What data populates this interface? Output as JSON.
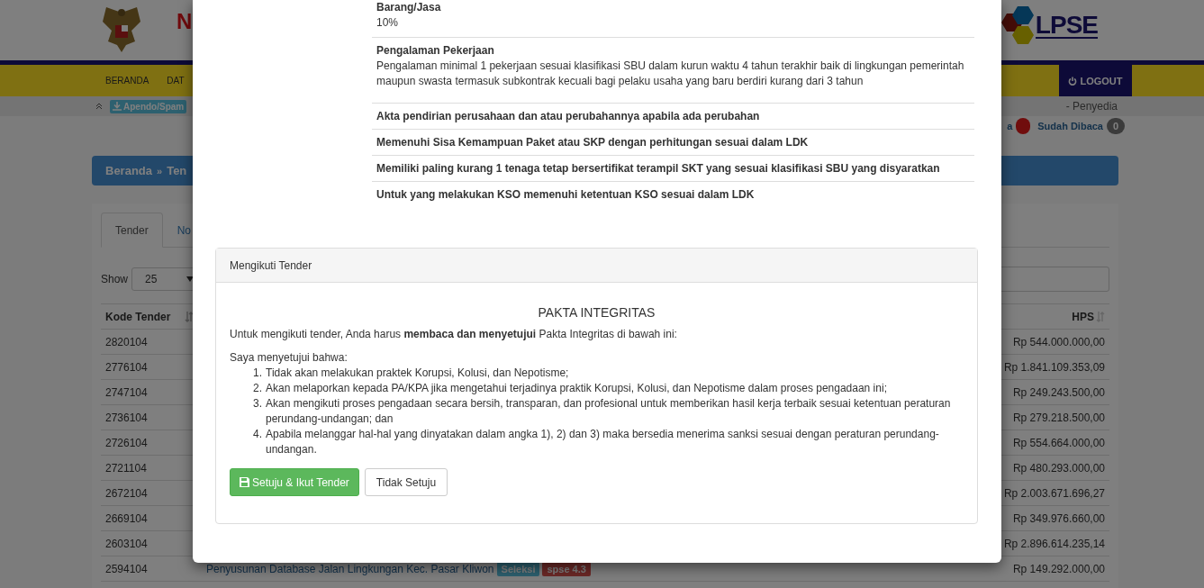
{
  "header": {
    "title_fragment": "N",
    "logo_text": "LPSE"
  },
  "nav": {
    "items": [
      {
        "label": "BERANDA"
      },
      {
        "label": "DAT"
      }
    ],
    "logout": "LOGOUT"
  },
  "subbar": {
    "download_button": "Apendo/Spam",
    "user_role": "- Penyedia",
    "unread_link": "a",
    "read_link": "Sudah Dibaca",
    "read_count": "0"
  },
  "breadcrumb": {
    "home": "Beranda",
    "separator": "»",
    "current": "Ten"
  },
  "tabs": [
    {
      "label": "Tender",
      "selected": true
    },
    {
      "label": "No",
      "selected": false
    }
  ],
  "show": {
    "label": "Show",
    "value": "25"
  },
  "table": {
    "columns": [
      "Kode Tender",
      "HPS"
    ],
    "rows": [
      {
        "code": "2820104",
        "hps": "Rp 544.000.000,00"
      },
      {
        "code": "2776104",
        "hps": "Rp 1.841.109.353,09"
      },
      {
        "code": "2747104",
        "hps": "Rp 249.243.500,00"
      },
      {
        "code": "2736104",
        "hps": "Rp 279.218.500,00"
      },
      {
        "code": "2726104",
        "hps": "Rp 554.664.000,00"
      },
      {
        "code": "2721104",
        "hps": "Rp 480.293.000,00"
      },
      {
        "code": "2672104",
        "hps": "Rp 2.003.671.696,27"
      },
      {
        "code": "2669104",
        "hps": "Rp 349.976.660,00"
      },
      {
        "code": "2603104",
        "hps": "Rp 2.896.614.235,14"
      },
      {
        "code": "2594104",
        "name": "Penyusunan Database Jalan Lingkungan Kec. Pasar Kliwon",
        "badges": [
          {
            "label": "Seleksi",
            "kind": "status"
          },
          {
            "label": "spse 4.3",
            "kind": "version"
          }
        ],
        "hps": "Rp 149.292.000,00"
      }
    ]
  },
  "modal": {
    "requirements": [
      {
        "title": "Barang/Jasa",
        "text": "10%"
      },
      {
        "title": "Pengalaman Pekerjaan",
        "text": "Pengalaman minimal 1 pekerjaan sesuai klasifikasi SBU dalam kurun waktu 4 tahun terakhir baik di lingkungan pemerintah maupun swasta termasuk subkontrak kecuali bagi pelaku usaha yang baru berdiri kurang dari 3 tahun"
      },
      {
        "title": "Akta pendirian perusahaan dan atau perubahannya apabila ada perubahan"
      },
      {
        "title": "Memenuhi Sisa Kemampuan Paket atau SKP dengan perhitungan sesuai dalam LDK"
      },
      {
        "title": "Memiliki paling kurang 1 tenaga tetap bersertifikat terampil SKT yang sesuai klasifikasi SBU yang disyaratkan"
      },
      {
        "title": "Untuk yang melakukan KSO memenuhi ketentuan KSO sesuai dalam LDK"
      }
    ],
    "panel": {
      "heading": "Mengikuti Tender",
      "title": "PAKTA INTEGRITAS",
      "intro": "Untuk mengikuti tender, Anda harus **membaca dan menyetujui** Pakta Integritas di bawah ini:",
      "lead": "Saya menyetujui bahwa:",
      "items": [
        {
          "number": "1.",
          "text": "Tidak akan melakukan praktek Korupsi, Kolusi, dan Nepotisme;"
        },
        {
          "number": "2.",
          "text": "Akan melaporkan kepada PA/KPA jika mengetahui terjadinya praktik Korupsi, Kolusi, dan Nepotisme dalam proses pengadaan ini;"
        },
        {
          "number": "3.",
          "text": "Akan mengikuti proses pengadaan secara bersih, transparan, dan profesional untuk memberikan hasil kerja terbaik sesuai ketentuan peraturan perundang-undangan; dan"
        },
        {
          "number": "4.",
          "text": "Apabila melanggar hal-hal yang dinyatakan dalam angka 1), 2) dan 3) maka bersedia menerima sanksi sesuai dengan peraturan perundang-undangan."
        }
      ],
      "agree_button": "Setuju & Ikut Tender",
      "disagree_button": "Tidak Setuju"
    }
  }
}
